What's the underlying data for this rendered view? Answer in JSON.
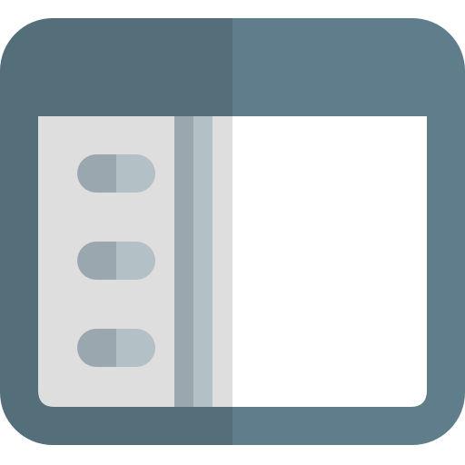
{
  "icon": {
    "name": "sidebar-layout-icon",
    "description_label": "",
    "colors": {
      "frame_dark": "#546e7a",
      "frame_light": "#607d8b",
      "sidebar_bg": "#dedede",
      "content_bg": "#ffffff",
      "pill_dark": "#9ba7af",
      "pill_light": "#b3c1c7",
      "divider_dark": "#9ba7af",
      "divider_light": "#b3c1c7"
    },
    "sidebar_items": [
      {
        "name": "sidebar-item-1"
      },
      {
        "name": "sidebar-item-2"
      },
      {
        "name": "sidebar-item-3"
      }
    ]
  }
}
